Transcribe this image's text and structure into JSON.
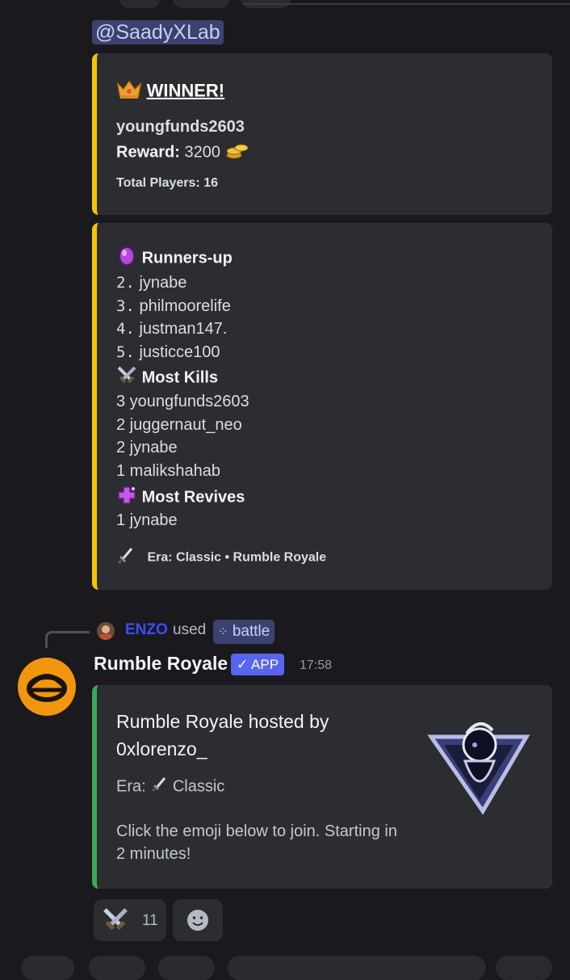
{
  "mention": "@SaadyXLab",
  "winner_embed": {
    "title": "WINNER!",
    "winner_name": "youngfunds2603",
    "reward_label": "Reward:",
    "reward_value": "3200",
    "total_players": "Total Players: 16"
  },
  "results_embed": {
    "runners_up_title": "Runners-up",
    "runners_up": [
      {
        "rank": "2.",
        "name": "jynabe"
      },
      {
        "rank": "3.",
        "name": "philmoorelife"
      },
      {
        "rank": "4.",
        "name": "justman147."
      },
      {
        "rank": "5.",
        "name": "justicce100"
      }
    ],
    "most_kills_title": "Most Kills",
    "most_kills": [
      "3 youngfunds2603",
      "2 juggernaut_neo",
      "2 jynabe",
      "1 malikshahab"
    ],
    "most_revives_title": "Most Revives",
    "most_revives": [
      "1 jynabe"
    ],
    "footer": "Era: Classic • Rumble Royale"
  },
  "reply": {
    "user": "ENZO",
    "used": "used",
    "command": "battle"
  },
  "message": {
    "author": "Rumble Royale",
    "badge": "APP",
    "time": "17:58",
    "embed": {
      "title_line1": "Rumble Royale hosted by",
      "title_line2": "0xlorenzo_",
      "era_label": "Era:",
      "era_value": "Classic",
      "desc_line1": "Click the emoji below to join. Starting in",
      "desc_line2": "2 minutes!"
    }
  },
  "reactions": {
    "swords_count": "11"
  },
  "colors": {
    "winner_bar": "#f5c400",
    "host_bar": "#3ba55c",
    "accent": "#5865f2"
  }
}
